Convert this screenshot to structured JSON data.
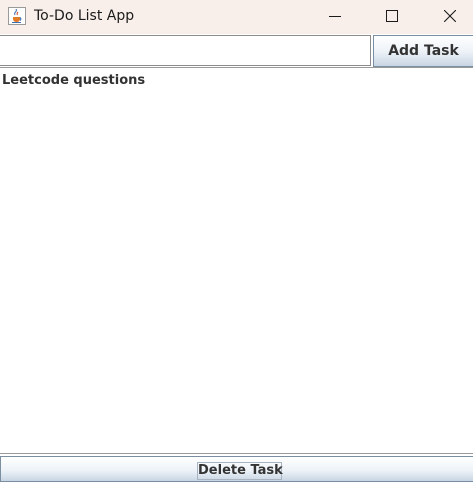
{
  "window": {
    "title": "To-Do List App",
    "icon": "java-cup-icon"
  },
  "controls": {
    "minimize_icon": "minimize-icon",
    "maximize_icon": "maximize-icon",
    "close_icon": "close-icon"
  },
  "form": {
    "task_value": "",
    "task_placeholder": "",
    "add_button_label": "Add Task"
  },
  "tasks": [
    {
      "label": "Leetcode questions"
    }
  ],
  "actions": {
    "delete_button_label": "Delete Task"
  },
  "colors": {
    "titlebar_bg": "#f8efea",
    "button_gradient_bottom": "#c8d5e3",
    "button_border": "#7b8fa3"
  }
}
